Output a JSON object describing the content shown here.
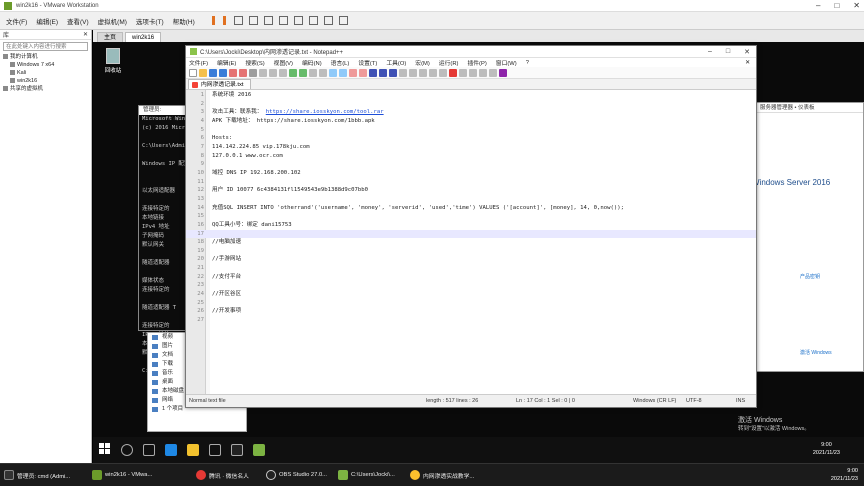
{
  "vmware": {
    "title": "win2k16 - VMware Workstation",
    "menu": [
      "文件(F)",
      "编辑(E)",
      "查看(V)",
      "虚拟机(M)",
      "选项卡(T)",
      "帮助(H)"
    ],
    "library_header": "库",
    "library_search": "在此处键入内容进行搜索",
    "library_items": [
      "我的计算机",
      "Windows 7 x64",
      "Kali",
      "win2k16",
      "共享的虚拟机"
    ]
  },
  "guest": {
    "tabs": [
      "主页",
      "win2k16"
    ],
    "recycle_label": "回收站",
    "cmd_title": "管理员: C:\\Windows\\system32\\cmd.exe",
    "cmd_lines": [
      "Microsoft Windows",
      "(c) 2016 Micros",
      "",
      "C:\\Users\\Admini",
      "",
      "Windows IP 配置",
      "",
      "",
      "以太网适配器",
      "",
      "   连接特定的",
      "   本地链接",
      "   IPv4 地址",
      "   子网掩码",
      "   默认网关",
      "",
      "隧道适配器",
      "",
      "   媒体状态",
      "   连接特定的",
      "",
      "隧道适配器 T",
      "",
      "   连接特定的",
      "   IPv6 地址",
      "   本地链接",
      "   默认网关",
      "",
      "C:\\Users\\Admini"
    ],
    "explorer_items": [
      "视频",
      "图片",
      "文档",
      "下载",
      "音乐",
      "桌面",
      "本地磁盘 (C:)",
      "网络",
      "1 个项目"
    ],
    "server_title": "服务器管理器 • 仪表板",
    "server_brand": "Windows Server 2016",
    "server_key1": "产品密钥",
    "server_key2": "激活 Windows",
    "activate_title": "激活 Windows",
    "activate_sub": "转到\"设置\"以激活 Windows。",
    "taskbar_time": "9:00",
    "taskbar_date": "2021/11/23"
  },
  "notepad": {
    "title": "C:\\Users\\Jocki\\Desktop\\内网渗透记录.txt - Notepad++",
    "menu": [
      "文件(F)",
      "编辑(E)",
      "搜索(S)",
      "视图(V)",
      "编码(N)",
      "语言(L)",
      "设置(T)",
      "工具(O)",
      "宏(M)",
      "运行(R)",
      "插件(P)",
      "窗口(W)",
      "?"
    ],
    "tab": "内网渗透记录.txt",
    "lines": [
      {
        "n": "1",
        "text": "系统环境 2016"
      },
      {
        "n": "2",
        "text": ""
      },
      {
        "n": "3",
        "text": "攻击工具：联系我：",
        "link": "https://share.iosskyon.com/tool.rar"
      },
      {
        "n": "4",
        "text": "APK 下载地址： https://share.iosskyon.com/1bbb.apk"
      },
      {
        "n": "5",
        "text": ""
      },
      {
        "n": "6",
        "text": "Hosts:"
      },
      {
        "n": "7",
        "text": "114.142.224.85  vip.178kju.com"
      },
      {
        "n": "8",
        "text": "127.0.0.1   www.ocr.com"
      },
      {
        "n": "9",
        "text": ""
      },
      {
        "n": "10",
        "text": "域控 DNS IP 192.168.200.102"
      },
      {
        "n": "11",
        "text": ""
      },
      {
        "n": "12",
        "text": "用户 ID 10077 6c4384131fl1549543e9b1388d9c07bb0"
      },
      {
        "n": "13",
        "text": ""
      },
      {
        "n": "14",
        "text": "充值SQL INSERT INTO 'otherrand'('username', 'money', 'serverid', 'used','time') VALUES ('[account]', [money], 14, 0,now());"
      },
      {
        "n": "15",
        "text": ""
      },
      {
        "n": "16",
        "text": "QQ工具小号：绑定 dani15753"
      },
      {
        "n": "17",
        "text": ""
      },
      {
        "n": "18",
        "text": "//电脑加速"
      },
      {
        "n": "19",
        "text": ""
      },
      {
        "n": "20",
        "text": "//手游网站"
      },
      {
        "n": "21",
        "text": ""
      },
      {
        "n": "22",
        "text": "//支付平台"
      },
      {
        "n": "23",
        "text": ""
      },
      {
        "n": "24",
        "text": "//开区谷区"
      },
      {
        "n": "25",
        "text": ""
      },
      {
        "n": "26",
        "text": "//开发事项"
      },
      {
        "n": "27",
        "text": ""
      }
    ],
    "current_line": "17",
    "status": {
      "type": "Normal text file",
      "length": "length : 517   lines : 26",
      "pos": "Ln : 17   Col : 1   Sel : 0 | 0",
      "eol": "Windows (CR LF)",
      "enc": "UTF-8",
      "mode": "INS"
    }
  },
  "host_taskbar": {
    "items": [
      "管理员: cmd (Admi...",
      "win2k16 - VMwa...",
      "腾讯 · 微信名人",
      "OBS Studio 27.0...",
      "C:\\Users\\Jocki\\...",
      "内网渗透实战教学..."
    ],
    "time": "9:00",
    "date": "2021/11/23"
  },
  "colors": {
    "npp_current_line": "#e8e8ff",
    "link": "#1d4ed8",
    "desktop": "#0a0a0a"
  }
}
